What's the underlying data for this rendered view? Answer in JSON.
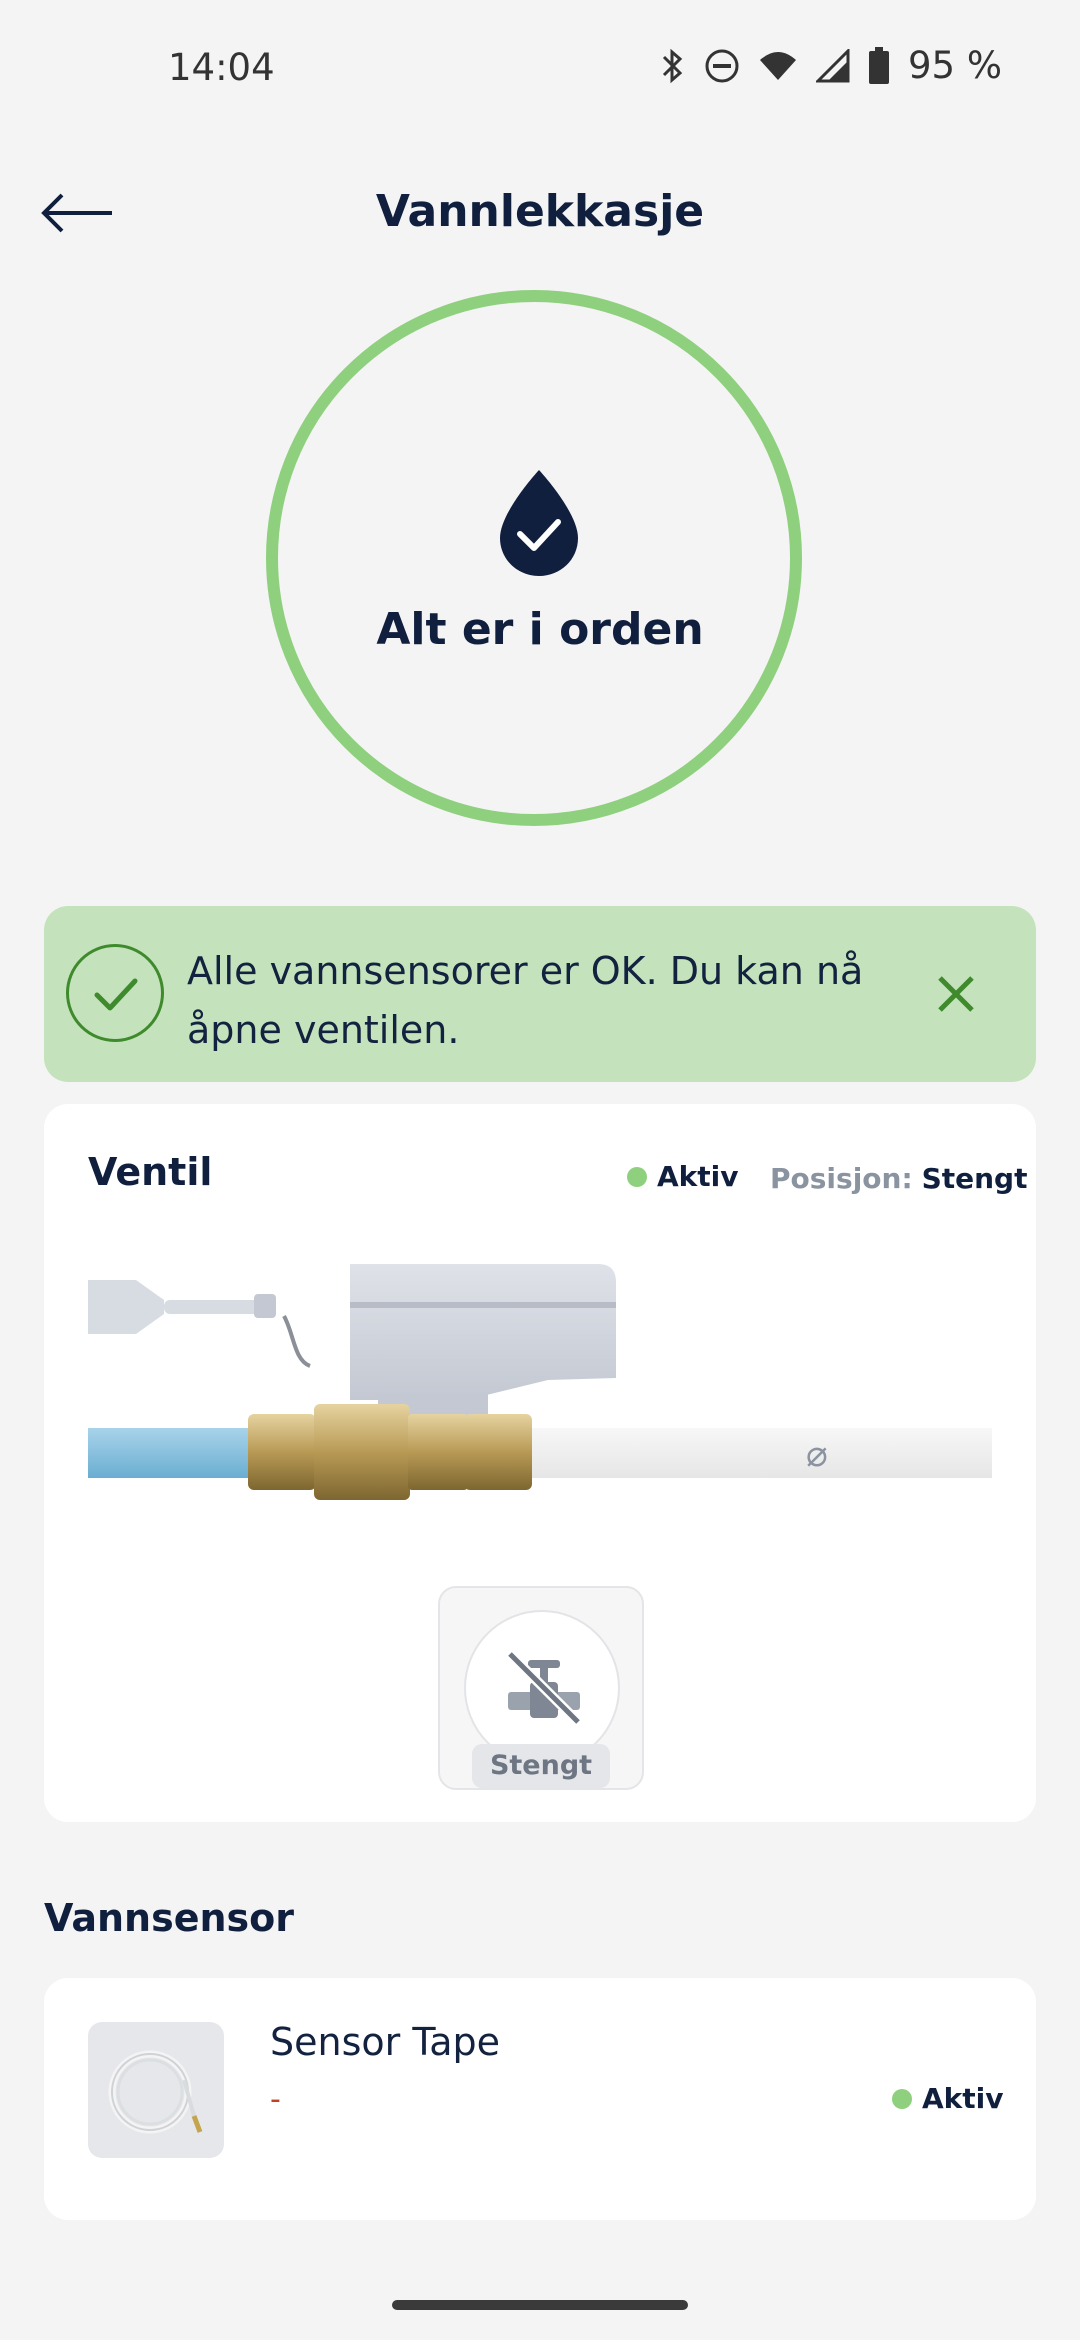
{
  "status_bar": {
    "time": "14:04",
    "battery": "95 %",
    "icons": [
      "bluetooth-icon",
      "do-not-disturb-icon",
      "wifi-icon",
      "signal-icon",
      "battery-icon"
    ]
  },
  "header": {
    "title": "Vannlekkasje",
    "back_icon": "arrow-left-icon"
  },
  "status_ring": {
    "label": "Alt er i orden",
    "icon": "water-drop-check-icon",
    "ring_color": "#8fd07e",
    "icon_color": "#0f1f3d"
  },
  "banner": {
    "message": "Alle vannsensorer er OK. Du kan nå åpne ventilen.",
    "icon": "check-circle-icon",
    "close_icon": "close-icon",
    "background": "#c4e3bc",
    "accent": "#3f8a2d"
  },
  "valve_card": {
    "title": "Ventil",
    "status": "Aktiv",
    "status_color": "#8fd07e",
    "position_label": "Posisjon:",
    "position_value": "Stengt",
    "control_label": "Stengt",
    "control_icon": "valve-off-icon"
  },
  "sensor_section": {
    "title": "Vannsensor",
    "items": [
      {
        "name": "Sensor Tape",
        "detail": "-",
        "status": "Aktiv",
        "thumbnail_icon": "sensor-tape-icon"
      }
    ]
  },
  "colors": {
    "background": "#f4f4f4",
    "card": "#ffffff",
    "text_primary": "#0f1f3d",
    "text_secondary": "#8a93a0",
    "alert_text": "#c0431d"
  }
}
